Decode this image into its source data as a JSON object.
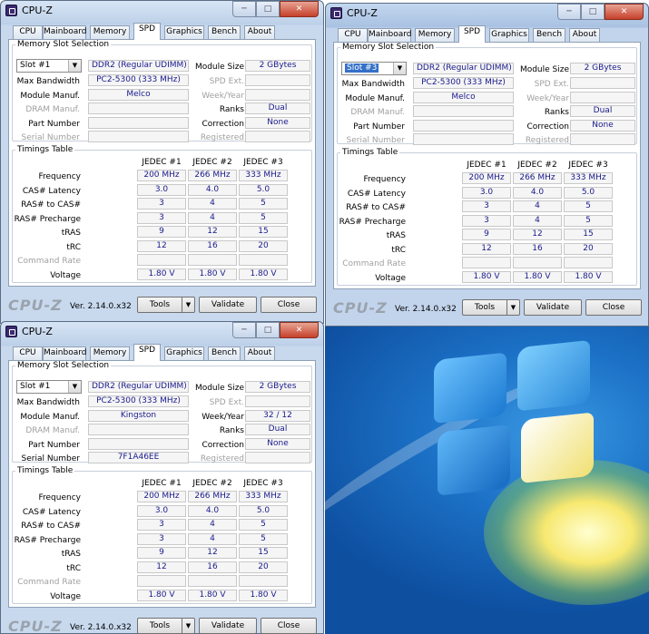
{
  "app_title": "CPU-Z",
  "tabs": [
    "CPU",
    "Mainboard",
    "Memory",
    "SPD",
    "Graphics",
    "Bench",
    "About"
  ],
  "labels": {
    "mem_slot_legend": "Memory Slot Selection",
    "module_size": "Module Size",
    "max_bandwidth": "Max Bandwidth",
    "spd_ext": "SPD Ext.",
    "module_manuf": "Module Manuf.",
    "week_year": "Week/Year",
    "dram_manuf": "DRAM Manuf.",
    "ranks": "Ranks",
    "part_number": "Part Number",
    "correction": "Correction",
    "serial_number": "Serial Number",
    "registered": "Registered",
    "timings_legend": "Timings Table",
    "frequency": "Frequency",
    "cas": "CAS# Latency",
    "ras_cas": "RAS# to CAS#",
    "ras_pre": "RAS# Precharge",
    "tras": "tRAS",
    "trc": "tRC",
    "cmd_rate": "Command Rate",
    "voltage": "Voltage"
  },
  "jedec_headers": [
    "JEDEC #1",
    "JEDEC #2",
    "JEDEC #3"
  ],
  "timings": {
    "frequency": [
      "200 MHz",
      "266 MHz",
      "333 MHz"
    ],
    "cas": [
      "3.0",
      "4.0",
      "5.0"
    ],
    "ras_cas": [
      "3",
      "4",
      "5"
    ],
    "ras_pre": [
      "3",
      "4",
      "5"
    ],
    "tras": [
      "9",
      "12",
      "15"
    ],
    "trc": [
      "12",
      "16",
      "20"
    ],
    "cmd_rate": [
      "",
      "",
      ""
    ],
    "voltage": [
      "1.80 V",
      "1.80 V",
      "1.80 V"
    ]
  },
  "footer": {
    "brand": "CPU-Z",
    "version": "Ver. 2.14.0.x32",
    "tools": "Tools",
    "validate": "Validate",
    "close": "Close"
  },
  "windows": [
    {
      "slot": "Slot #1",
      "mem_type": "DDR2 (Regular UDIMM)",
      "module_size": "2 GBytes",
      "max_bandwidth": "PC2-5300 (333 MHz)",
      "spd_ext": "",
      "module_manuf": "Melco",
      "week_year": "",
      "dram_manuf": "",
      "ranks": "Dual",
      "part_number": "",
      "correction": "None",
      "serial_number": "",
      "registered": ""
    },
    {
      "slot": "Slot #3",
      "mem_type": "DDR2 (Regular UDIMM)",
      "module_size": "2 GBytes",
      "max_bandwidth": "PC2-5300 (333 MHz)",
      "spd_ext": "",
      "module_manuf": "Melco",
      "week_year": "",
      "dram_manuf": "",
      "ranks": "Dual",
      "part_number": "",
      "correction": "None",
      "serial_number": "",
      "registered": ""
    },
    {
      "slot": "Slot #1",
      "mem_type": "DDR2 (Regular UDIMM)",
      "module_size": "2 GBytes",
      "max_bandwidth": "PC2-5300 (333 MHz)",
      "spd_ext": "",
      "module_manuf": "Kingston",
      "week_year": "32 / 12",
      "dram_manuf": "",
      "ranks": "Dual",
      "part_number": "",
      "correction": "None",
      "serial_number": "7F1A46EE",
      "registered": ""
    }
  ]
}
